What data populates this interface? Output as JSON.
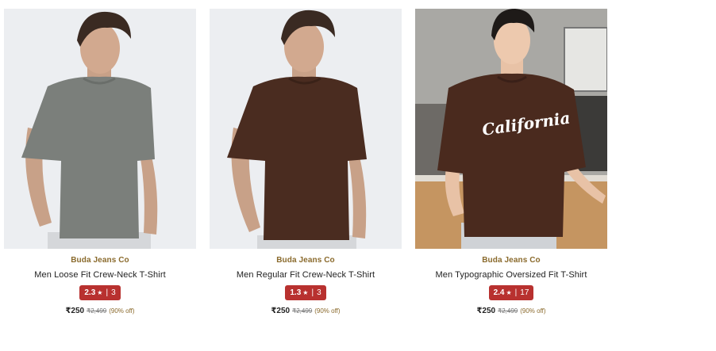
{
  "products": [
    {
      "brand": "Buda Jeans Co",
      "title": "Men Loose Fit Crew-Neck T-Shirt",
      "rating": "2.3",
      "star": "★",
      "separator": "|",
      "reviews": "3",
      "price": "₹250",
      "mrp": "₹2,499",
      "discount": "(90% off)",
      "shirt_color": "#7b7f7b"
    },
    {
      "brand": "Buda Jeans Co",
      "title": "Men Regular Fit Crew-Neck T-Shirt",
      "rating": "1.3",
      "star": "★",
      "separator": "|",
      "reviews": "3",
      "price": "₹250",
      "mrp": "₹2,499",
      "discount": "(90% off)",
      "shirt_color": "#4a2c20"
    },
    {
      "brand": "Buda Jeans Co",
      "title": "Men Typographic Oversized Fit T-Shirt",
      "rating": "2.4",
      "star": "★",
      "separator": "|",
      "reviews": "17",
      "price": "₹250",
      "mrp": "₹2,499",
      "discount": "(90% off)",
      "shirt_color": "#4a2a1e",
      "print_text": "California"
    }
  ],
  "colors": {
    "brand_text": "#8a6a2c",
    "rating_badge": "#b8312f"
  }
}
